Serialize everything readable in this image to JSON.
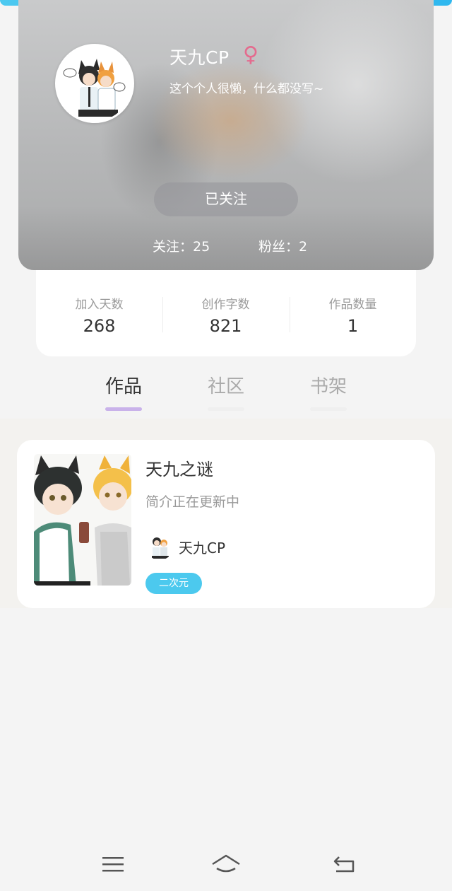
{
  "profile": {
    "username": "天九CP",
    "gender_icon": "female-symbol",
    "bio": "这个个人很懒，什么都没写~",
    "follow_button_label": "已关注",
    "following_text": "关注：25",
    "fans_text": "粉丝：2"
  },
  "stats": [
    {
      "label": "加入天数",
      "value": "268"
    },
    {
      "label": "创作字数",
      "value": "821"
    },
    {
      "label": "作品数量",
      "value": "1"
    }
  ],
  "tabs": [
    {
      "label": "作品",
      "active": true
    },
    {
      "label": "社区",
      "active": false
    },
    {
      "label": "书架",
      "active": false
    }
  ],
  "works": [
    {
      "title": "天九之谜",
      "description": "简介正在更新中",
      "author": "天九CP",
      "tag": "二次元"
    }
  ],
  "nav": {
    "menu_icon": "menu-icon",
    "home_icon": "home-icon",
    "back_icon": "back-icon"
  },
  "colors": {
    "accent_blue": "#4cc9ee",
    "tab_indicator": "#c9b2ea",
    "gender_pink": "#e46b8e"
  }
}
